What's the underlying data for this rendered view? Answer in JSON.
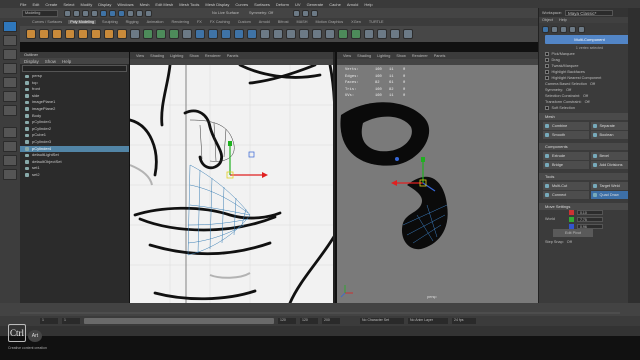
{
  "menubar": {
    "items": [
      "File",
      "Edit",
      "Create",
      "Select",
      "Modify",
      "Display",
      "Windows",
      "Mesh",
      "Edit Mesh",
      "Mesh Tools",
      "Mesh Display",
      "Curves",
      "Surfaces",
      "Deform",
      "UV",
      "Generate",
      "Cache",
      "Arnold",
      "Help"
    ]
  },
  "statusline": {
    "mode": "Modeling",
    "live_surface": "No Live Surface",
    "symmetry": "Symmetry: Off"
  },
  "shelf": {
    "tabs": [
      "Curves / Surfaces",
      "Poly Modeling",
      "Sculpting",
      "Rigging",
      "Animation",
      "Rendering",
      "FX",
      "FX Caching",
      "Custom",
      "Arnold",
      "Bifrost",
      "MASH",
      "Motion Graphics",
      "XGen",
      "TURTLE"
    ],
    "active_tab": "Poly Modeling"
  },
  "outliner": {
    "title": "Outliner",
    "menu": [
      "Display",
      "Show",
      "Help"
    ],
    "items": [
      {
        "label": "persp",
        "selected": false
      },
      {
        "label": "top",
        "selected": false
      },
      {
        "label": "front",
        "selected": false
      },
      {
        "label": "side",
        "selected": false
      },
      {
        "label": "imagePlane1",
        "selected": false
      },
      {
        "label": "imagePlane2",
        "selected": false
      },
      {
        "label": "Body",
        "selected": false
      },
      {
        "label": "pCylinder1",
        "selected": false
      },
      {
        "label": "pCylinder2",
        "selected": false
      },
      {
        "label": "pCube1",
        "selected": false
      },
      {
        "label": "pCylinder3",
        "selected": false
      },
      {
        "label": "pCylinder4",
        "selected": true
      },
      {
        "label": "defaultLightSet",
        "selected": false
      },
      {
        "label": "defaultObjectSet",
        "selected": false
      },
      {
        "label": "set1",
        "selected": false
      },
      {
        "label": "set2",
        "selected": false
      }
    ]
  },
  "viewport_left": {
    "menu": [
      "View",
      "Shading",
      "Lighting",
      "Show",
      "Renderer",
      "Panels"
    ]
  },
  "viewport_right": {
    "menu": [
      "View",
      "Shading",
      "Lighting",
      "Show",
      "Renderer",
      "Panels"
    ],
    "hud": [
      {
        "label": "Verts:",
        "a": "160",
        "b": "11",
        "c": "0"
      },
      {
        "label": "Edges:",
        "a": "160",
        "b": "11",
        "c": "0"
      },
      {
        "label": "Faces:",
        "a": "82",
        "b": "61",
        "c": "0"
      },
      {
        "label": "Tris:",
        "a": "160",
        "b": "82",
        "c": "0"
      },
      {
        "label": "UVs:",
        "a": "160",
        "b": "11",
        "c": "0"
      }
    ],
    "camera_label": "persp"
  },
  "attribute_panel": {
    "workspace_label": "Workspace:",
    "workspace_value": "Maya Classic*",
    "menu": [
      "Object",
      "Help"
    ],
    "multi_component_button": "Multi-Component",
    "selection_info": "1 vertex selected",
    "pick_options": [
      "Pick/Marquee",
      "Drag",
      "Tweak/Marquee",
      "Highlight Backfaces",
      "Highlight Nearest Component"
    ],
    "camera_based": "Camera Based Selection",
    "symmetry": "Symmetry:",
    "selection_constraint": "Selection Constraint:",
    "transform_constraint": "Transform Constraint:",
    "soft_selection": "Soft Selection",
    "mesh_header": "Mesh",
    "mesh_buttons": [
      "Combine",
      "Separate",
      "Smooth",
      "Boolean"
    ],
    "components_header": "Components",
    "components_buttons": [
      "Extrude",
      "Bevel",
      "Bridge",
      "Add Divisions"
    ],
    "tools_header": "Tools",
    "tools_buttons": [
      "Multi-Cut",
      "Target Weld",
      "Connect",
      "Quad Draw"
    ],
    "move_header": "Move Settings",
    "world_label": "World",
    "xyz": [
      {
        "axis": "X",
        "value": "0.10",
        "color": "#c33"
      },
      {
        "axis": "Y",
        "value": "7.75",
        "color": "#3a3"
      },
      {
        "axis": "Z",
        "value": "0.96",
        "color": "#35c"
      }
    ],
    "edit_pivot": "Edit Pivot",
    "step_snap": "Step Snap:",
    "off": "Off"
  },
  "timeline": {
    "start": "1",
    "end": "120",
    "range_start": "1",
    "range_end": "120",
    "range_end2": "200",
    "character_set": "No Character Set",
    "anim_layer": "No Anim Layer",
    "fps": "24 fps"
  },
  "watermark": {
    "brand_a": "Ctrl",
    "brand_b": "Art",
    "caption": "Creative content creation"
  }
}
